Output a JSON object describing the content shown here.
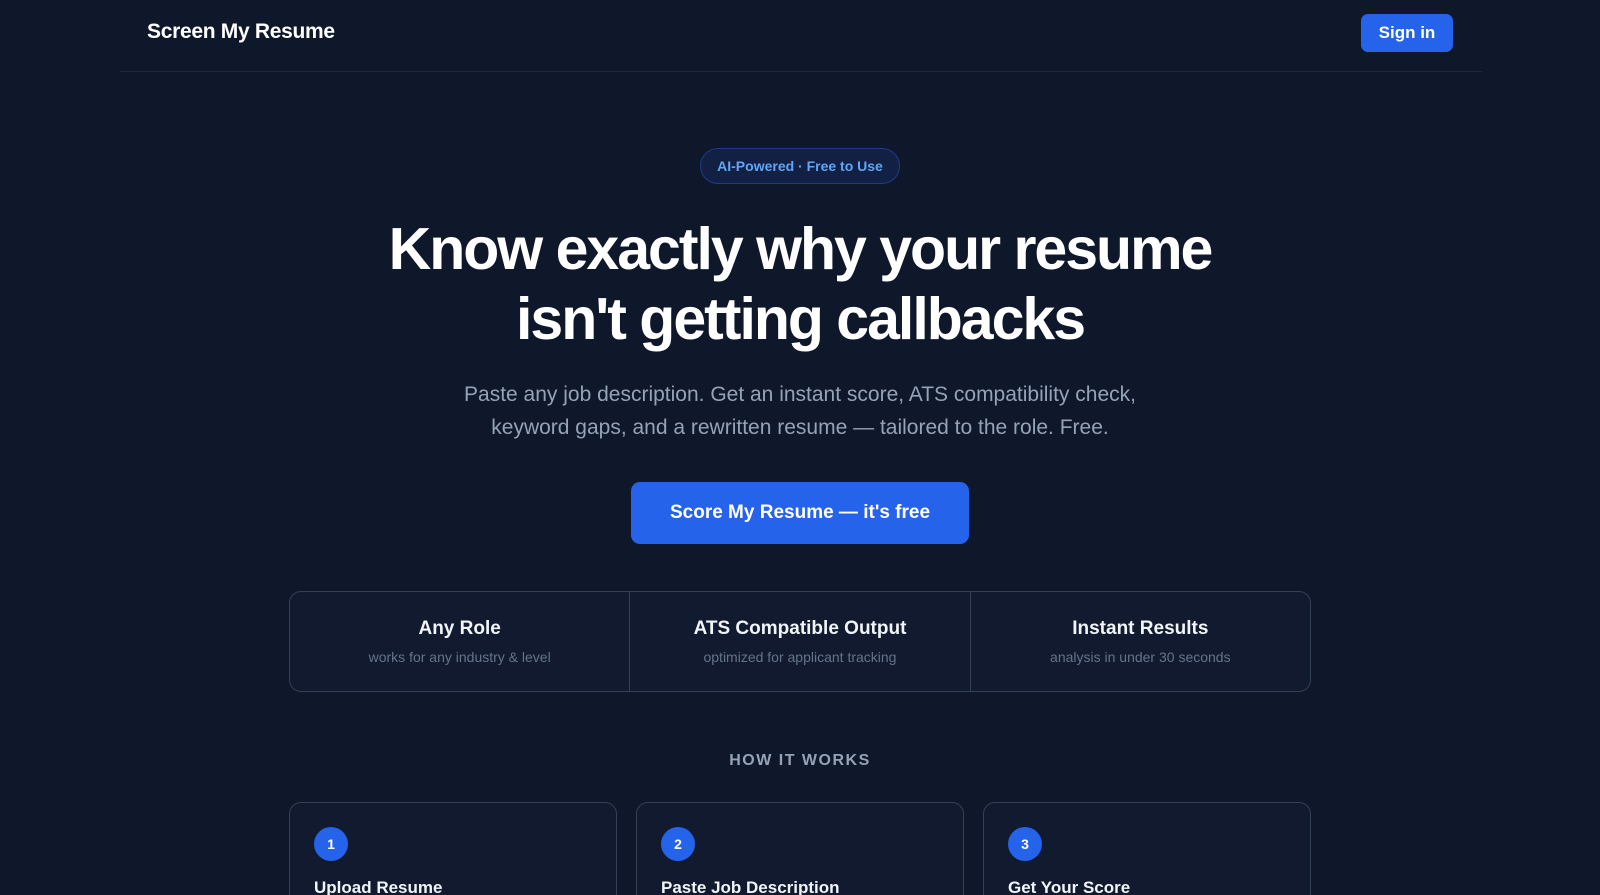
{
  "header": {
    "brand": "Screen My Resume",
    "signin_label": "Sign in"
  },
  "hero": {
    "badge": "AI-Powered · Free to Use",
    "title_line1": "Know exactly why your resume",
    "title_line2": "isn't getting callbacks",
    "subtitle_line1": "Paste any job description. Get an instant score, ATS compatibility check,",
    "subtitle_line2": "keyword gaps, and a rewritten resume — tailored to the role. Free.",
    "cta_label": "Score My Resume — it's free"
  },
  "features": [
    {
      "title": "Any Role",
      "subtitle": "works for any industry & level"
    },
    {
      "title": "ATS Compatible Output",
      "subtitle": "optimized for applicant tracking"
    },
    {
      "title": "Instant Results",
      "subtitle": "analysis in under 30 seconds"
    }
  ],
  "how_it_works": {
    "heading": "HOW IT WORKS",
    "steps": [
      {
        "number": "1",
        "title": "Upload Resume"
      },
      {
        "number": "2",
        "title": "Paste Job Description"
      },
      {
        "number": "3",
        "title": "Get Your Score"
      }
    ]
  },
  "colors": {
    "background": "#0f172a",
    "accent": "#2563eb",
    "badge_text": "#60a5fa",
    "muted_text": "#94a3b8"
  }
}
